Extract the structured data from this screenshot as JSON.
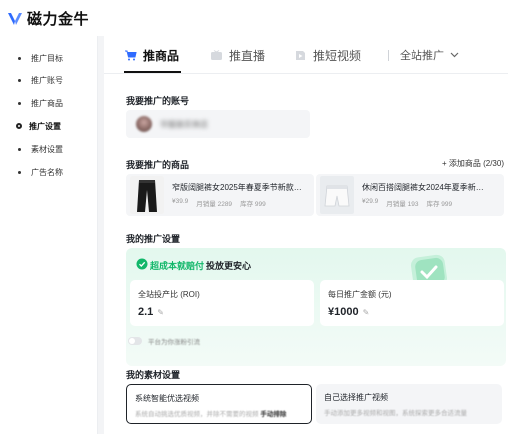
{
  "app": {
    "title": "磁力金牛"
  },
  "sidebar": {
    "items": [
      {
        "label": "推广目标",
        "active": false
      },
      {
        "label": "推广账号",
        "active": false
      },
      {
        "label": "推广商品",
        "active": false
      },
      {
        "label": "推广设置",
        "active": true
      },
      {
        "label": "素材设置",
        "active": false
      },
      {
        "label": "广告名称",
        "active": false
      }
    ]
  },
  "tabs": [
    {
      "label": "推商品",
      "icon": "cart-icon",
      "active": true
    },
    {
      "label": "推直播",
      "icon": "tv-icon",
      "active": false
    },
    {
      "label": "推短视频",
      "icon": "play-icon",
      "active": false
    }
  ],
  "scope_dropdown": {
    "label": "全站推广"
  },
  "account_section": {
    "title": "我要推广的账号",
    "account_name": "华服装实体店"
  },
  "product_section": {
    "title": "我要推广的商品",
    "add_label": "+ 添加商品 (2/30)",
    "products": [
      {
        "title": "窄版阔腿裤女2025年春夏季节新款…",
        "price": "¥39.9",
        "sales": "月销量 2289",
        "stock": "库存 999"
      },
      {
        "title": "休闲百搭阔腿裤女2024年夏季新…",
        "price": "¥29.9",
        "sales": "月销量 193",
        "stock": "库存 999"
      }
    ]
  },
  "promo_section": {
    "title": "我的推广设置",
    "banner_strong": "超成本就赔付",
    "banner_rest": "投放更安心",
    "roi_label": "全站投产比 (ROI)",
    "roi_value": "2.1",
    "budget_label": "每日推广金额 (元)",
    "budget_value": "¥1000",
    "toggle_label": "平台为你涨粉引流"
  },
  "material_section": {
    "title": "我的素材设置",
    "options": [
      {
        "title": "系统智能优选视频",
        "desc": "系统自动挑选优质视频，并除不需要的视频",
        "link": "手动排除",
        "selected": true
      },
      {
        "title": "自己选择推广视频",
        "desc": "手动添加更多视频和视图，系统探索更多合适流量",
        "link": "",
        "selected": false
      }
    ]
  },
  "colors": {
    "accent_green": "#12b76a",
    "logo_blue": "#2f6bff"
  }
}
